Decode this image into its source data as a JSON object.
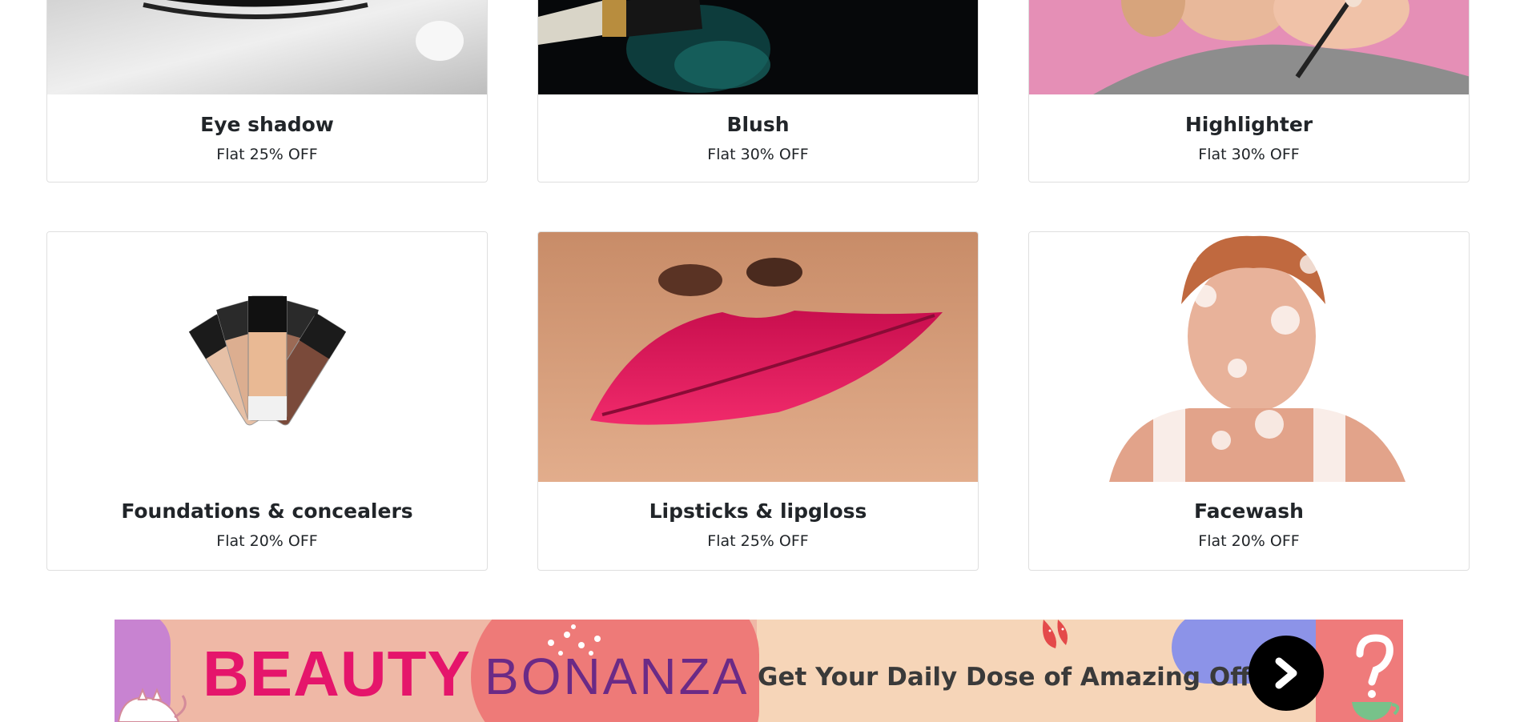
{
  "products": [
    {
      "title": "Eye shadow",
      "offer": "Flat 25% OFF",
      "image": "eye-shadow-photo"
    },
    {
      "title": "Blush",
      "offer": "Flat 30% OFF",
      "image": "blush-brush-photo"
    },
    {
      "title": "Highlighter",
      "offer": "Flat 30% OFF",
      "image": "highlighter-photo"
    },
    {
      "title": "Foundations & concealers",
      "offer": "Flat 20% OFF",
      "image": "foundation-bottles-photo"
    },
    {
      "title": "Lipsticks & lipgloss",
      "offer": "Flat 25% OFF",
      "image": "lipstick-lips-photo"
    },
    {
      "title": "Facewash",
      "offer": "Flat 20% OFF",
      "image": "facewash-splash-photo"
    }
  ],
  "banner": {
    "beauty": "BEAUTY",
    "bonanza": "BONANZA",
    "tagline": "Get Your Daily Dose of Amazing Offers",
    "button_icon": "chevron-right-icon",
    "colors": {
      "beauty": "#e5156b",
      "bonanza": "#6b2a86",
      "background": "#f5d4b8"
    }
  }
}
